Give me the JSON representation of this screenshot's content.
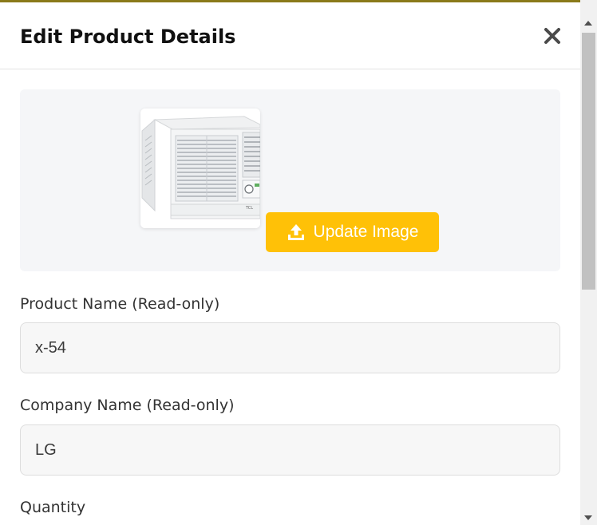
{
  "modal": {
    "title": "Edit Product Details",
    "close_icon": "close-icon"
  },
  "image_section": {
    "product_image": "window-air-conditioner-image",
    "update_button_label": "Update Image",
    "update_button_icon": "upload-icon",
    "update_button_color": "#ffc107"
  },
  "fields": {
    "product_name": {
      "label": "Product Name (Read-only)",
      "value": "x-54"
    },
    "company_name": {
      "label": "Company Name (Read-only)",
      "value": "LG"
    },
    "quantity": {
      "label": "Quantity"
    }
  }
}
